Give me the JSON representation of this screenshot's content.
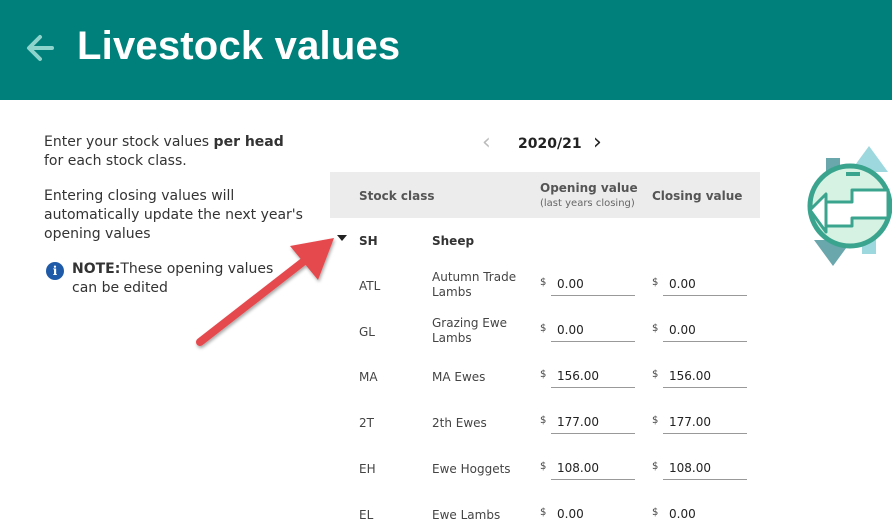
{
  "header": {
    "title": "Livestock values"
  },
  "intro": {
    "p1_before": "Enter your stock values ",
    "p1_bold": "per head",
    "p1_after": " for each stock class.",
    "p2": "Entering closing values will automatically update the next year's opening values"
  },
  "note": {
    "label": "NOTE:",
    "text": "These opening values can be edited"
  },
  "year_nav": {
    "label": "2020/21"
  },
  "table": {
    "col_class": "Stock class",
    "col_opening": "Opening value",
    "col_opening_sub": "(last years closing)",
    "col_closing": "Closing value",
    "currency": "$",
    "group": {
      "code": "SH",
      "name": "Sheep"
    },
    "rows": [
      {
        "code": "ATL",
        "name": "Autumn Trade Lambs",
        "opening": "0.00",
        "closing": "0.00"
      },
      {
        "code": "GL",
        "name": "Grazing Ewe Lambs",
        "opening": "0.00",
        "closing": "0.00"
      },
      {
        "code": "MA",
        "name": "MA Ewes",
        "opening": "156.00",
        "closing": "156.00"
      },
      {
        "code": "2T",
        "name": "2th Ewes",
        "opening": "177.00",
        "closing": "177.00"
      },
      {
        "code": "EH",
        "name": "Ewe Hoggets",
        "opening": "108.00",
        "closing": "108.00"
      },
      {
        "code": "EL",
        "name": "Ewe Lambs",
        "opening": "0.00",
        "closing": "0.00"
      }
    ]
  },
  "colors": {
    "header_bg": "#00807a",
    "annotation_arrow": "#e5484d",
    "note_icon": "#1e5aa8"
  },
  "icons": {
    "back": "arrow-left-icon",
    "prev": "chevron-left-icon",
    "next": "chevron-right-icon",
    "info": "info-icon",
    "collapse": "caret-down-icon",
    "transfer": "transfer-arrows-icon"
  }
}
